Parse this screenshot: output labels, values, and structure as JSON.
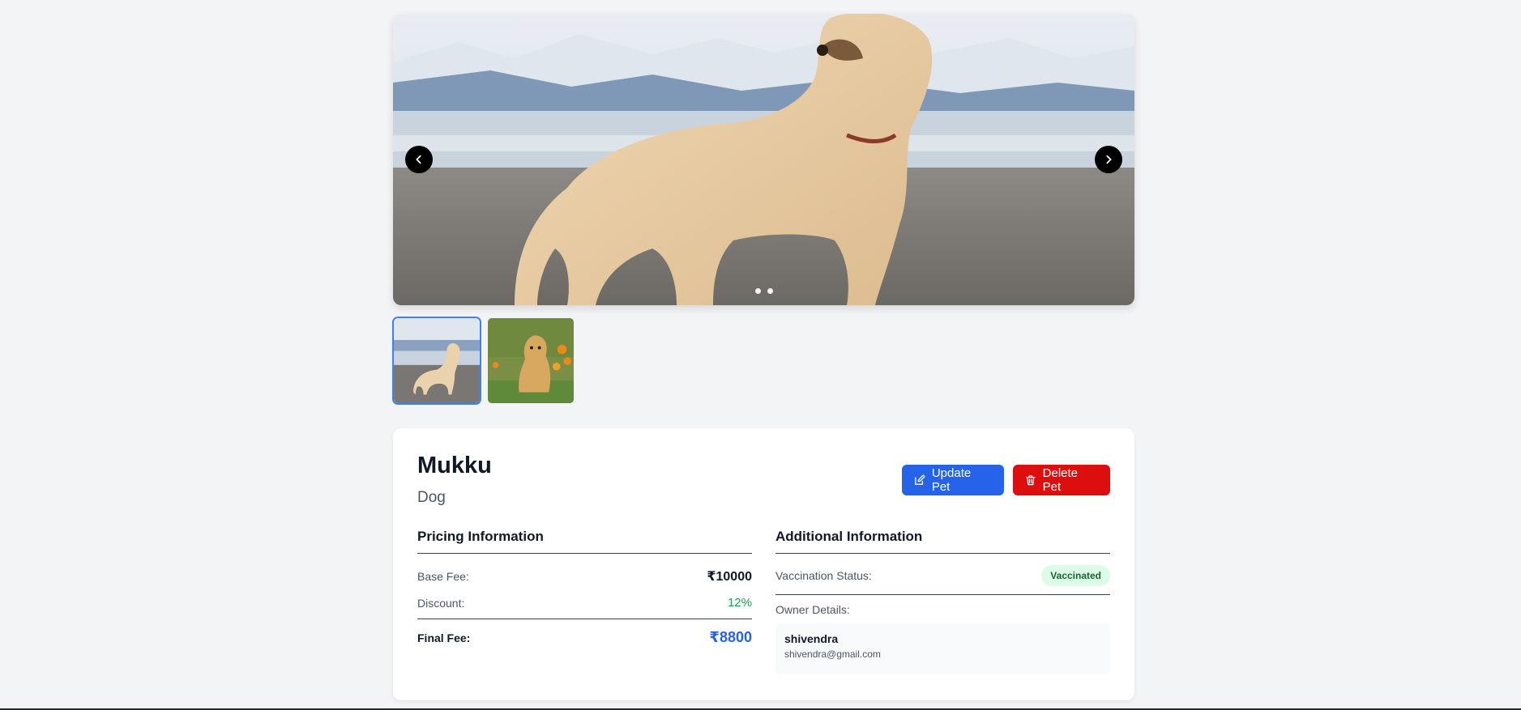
{
  "carousel": {
    "prev_icon": "chevron-left-icon",
    "next_icon": "chevron-right-icon",
    "slide_count": 2,
    "active_slide": 1
  },
  "thumbnails": [
    {
      "subject": "labrador-on-beach",
      "active": true
    },
    {
      "subject": "puppy-on-grass",
      "active": false
    }
  ],
  "pet": {
    "name": "Mukku",
    "type": "Dog"
  },
  "actions": {
    "update_label": "Update Pet",
    "update_icon": "edit-icon",
    "delete_label": "Delete Pet",
    "delete_icon": "trash-icon",
    "update_color": "#2563eb",
    "delete_color": "#dc0e0e"
  },
  "pricing": {
    "title": "Pricing Information",
    "base_label": "Base Fee:",
    "base_value": "₹10000",
    "discount_label": "Discount:",
    "discount_value": "12%",
    "final_label": "Final Fee:",
    "final_value": "₹8800"
  },
  "additional": {
    "title": "Additional Information",
    "vaccination_label": "Vaccination Status:",
    "vaccination_value": "Vaccinated",
    "owner_label": "Owner Details:",
    "owner_name": "shivendra",
    "owner_email": "shivendra@gmail.com"
  }
}
